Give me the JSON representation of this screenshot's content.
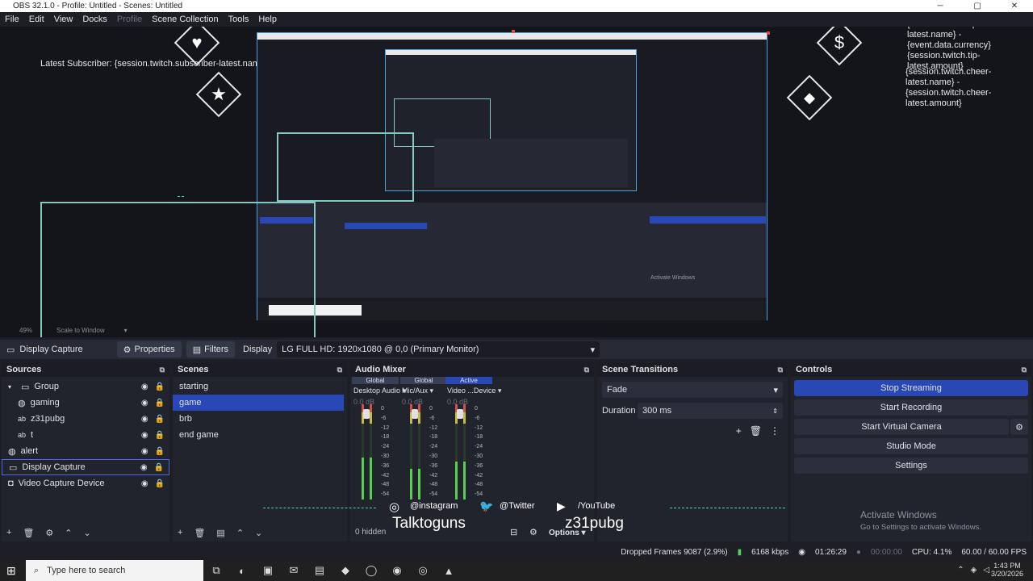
{
  "window": {
    "title": "OBS 32.1.0 - Profile: Untitled - Scenes: Untitled",
    "controls": [
      "─",
      "▢",
      "✕"
    ]
  },
  "menu": {
    "items": [
      "File",
      "Edit",
      "View",
      "Docks",
      "Profile",
      "Scene Collection",
      "Tools",
      "Help"
    ]
  },
  "preview": {
    "latest_subscriber": "Latest Subscriber: {session.twitch.subscriber-latest.name}",
    "latest_tipper": "Latest Tipper: {session.twitch.tip-latest.name} - {event.data.currency} {session.twitch.tip-latest.amount}",
    "latest_cheer": "{session.twitch.cheer-latest.name} - {session.twitch.cheer-latest.amount}",
    "zoom": "49%",
    "scale_mode": "Scale to Window",
    "activate_title": "Activate Windows",
    "activate_sub": "Go to Settings to activate Windows."
  },
  "context_bar": {
    "source_name": "Display Capture",
    "properties": "Properties",
    "filters": "Filters",
    "display_label": "Display",
    "display_value": "LG FULL HD: 1920x1080 @ 0,0 (Primary Monitor)"
  },
  "sources": {
    "title": "Sources",
    "items": [
      {
        "label": "Group",
        "icon": "folder-icon",
        "indent": 0
      },
      {
        "label": "gaming",
        "icon": "globe-icon",
        "indent": 1
      },
      {
        "label": "z31pubg",
        "icon": "text-icon",
        "indent": 1
      },
      {
        "label": "t",
        "icon": "text-icon",
        "indent": 1
      },
      {
        "label": "alert",
        "icon": "globe-icon",
        "indent": 0
      },
      {
        "label": "Display Capture",
        "icon": "monitor-icon",
        "indent": 0
      },
      {
        "label": "Video Capture Device",
        "icon": "camera-icon",
        "indent": 0
      }
    ],
    "selected_index": 5
  },
  "scenes": {
    "title": "Scenes",
    "items": [
      "starting",
      "game",
      "brb",
      "end game"
    ],
    "selected_index": 1
  },
  "mixer": {
    "title": "Audio Mixer",
    "hidden_label": "0 hidden",
    "options_label": "Options",
    "channels": [
      {
        "badge": "Global",
        "name": "Desktop Audio",
        "db": "0.0 dB",
        "level": 0.55
      },
      {
        "badge": "Global",
        "name": "Mic/Aux",
        "db": "0.0 dB",
        "level": 0.4
      },
      {
        "badge": "Active",
        "name": "Video ...Device",
        "db": "0.0 dB",
        "level": 0.5
      }
    ],
    "scale": [
      "0",
      "-6",
      "-12",
      "-18",
      "-24",
      "-30",
      "-36",
      "-42",
      "-48",
      "-54"
    ]
  },
  "transitions": {
    "title": "Scene Transitions",
    "transition": "Fade",
    "duration_label": "Duration",
    "duration_value": "300 ms"
  },
  "controls": {
    "title": "Controls",
    "buttons": [
      "Stop Streaming",
      "Start Recording",
      "Start Virtual Camera",
      "Studio Mode",
      "Settings"
    ]
  },
  "social": {
    "instagram": "@instagram",
    "twitter": "@Twitter",
    "youtube": "/YouTube",
    "name1": "Talktoguns",
    "name2": "z31pubg"
  },
  "statusbar": {
    "dropped": "Dropped Frames 9087 (2.9%)",
    "bitrate": "6168 kbps",
    "stream_time": "01:26:29",
    "rec_time": "00:00:00",
    "cpu": "CPU: 4.1%",
    "fps": "60.00 / 60.00 FPS"
  },
  "taskbar": {
    "search_placeholder": "Type here to search",
    "time": "1:43 PM",
    "date": "3/20/2026"
  },
  "colors": {
    "accent": "#2948b5",
    "meter_green": "#57d04f",
    "selection": "#86c7c0"
  }
}
